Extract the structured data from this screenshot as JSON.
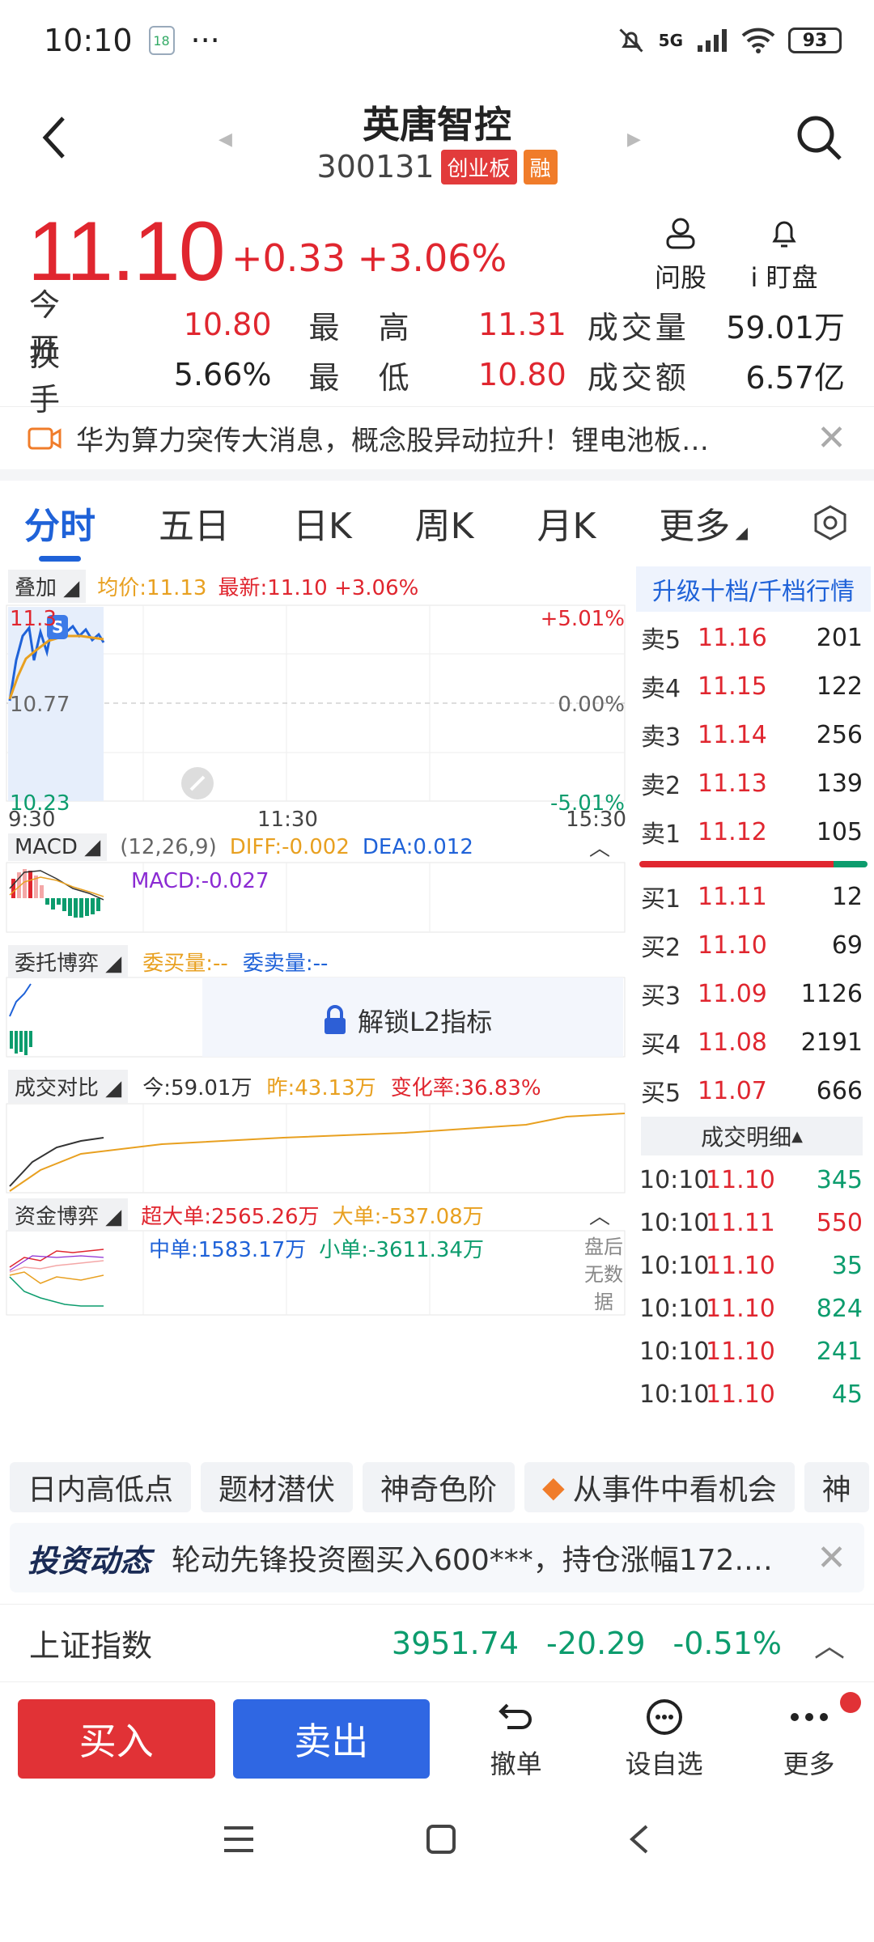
{
  "status": {
    "time": "10:10",
    "badge": "18",
    "dots": "···",
    "net": "5G",
    "battery": "93"
  },
  "header": {
    "title": "英唐智控",
    "code": "300131",
    "board_tag": "创业板",
    "margin_tag": "融"
  },
  "price": {
    "last": "11.10",
    "change": "+0.33",
    "pct": "+3.06%",
    "ask_label": "问股",
    "watch_label": "i 盯盘"
  },
  "quotes": {
    "rows": [
      {
        "l1": "今 开",
        "v1": "10.80",
        "c1": "red",
        "l2": "最 高",
        "v2": "11.31",
        "c2": "red",
        "l3": "成交量",
        "v3": "59.01万"
      },
      {
        "l1": "换 手",
        "v1": "5.66%",
        "c1": "dark",
        "l2": "最 低",
        "v2": "10.80",
        "c2": "red",
        "l3": "成交额",
        "v3": "6.57亿"
      }
    ]
  },
  "news": {
    "text": "华为算力突传大消息，概念股异动拉升！锂电池板…",
    "close": "✕"
  },
  "tabs": [
    "分时",
    "五日",
    "日K",
    "周K",
    "月K",
    "更多"
  ],
  "chart": {
    "overlay": "叠加",
    "avg": "均价:11.13",
    "latest": "最新:11.10 +3.06%",
    "high": "11.3",
    "mid": "10.77",
    "low": "10.23",
    "pos": "+5.01%",
    "zero": "0.00%",
    "neg": "-5.01%",
    "t1": "9:30",
    "t2": "11:30",
    "t3": "15:30"
  },
  "macd": {
    "label": "MACD",
    "params": "(12,26,9)",
    "diff": "DIFF:-0.002",
    "dea": "DEA:0.012",
    "macd": "MACD:-0.027"
  },
  "entrust": {
    "label": "委托博弈",
    "buy": "委买量:--",
    "sell": "委卖量:--",
    "unlock": "解锁L2指标"
  },
  "volume": {
    "label": "成交对比",
    "today": "今:59.01万",
    "yest": "昨:43.13万",
    "rate": "变化率:36.83%"
  },
  "fund": {
    "label": "资金博弈",
    "xl": "超大单:2565.26万",
    "l": "大单:-537.08万",
    "m": "中单:1583.17万",
    "s": "小单:-3611.34万",
    "after1": "盘后",
    "after2": "无数",
    "after3": "据"
  },
  "orderbook": {
    "upgrade": "升级十档/千档行情",
    "asks": [
      {
        "l": "卖5",
        "p": "11.16",
        "v": "201"
      },
      {
        "l": "卖4",
        "p": "11.15",
        "v": "122"
      },
      {
        "l": "卖3",
        "p": "11.14",
        "v": "256"
      },
      {
        "l": "卖2",
        "p": "11.13",
        "v": "139"
      },
      {
        "l": "卖1",
        "p": "11.12",
        "v": "105"
      }
    ],
    "bids": [
      {
        "l": "买1",
        "p": "11.11",
        "v": "12"
      },
      {
        "l": "买2",
        "p": "11.10",
        "v": "69"
      },
      {
        "l": "买3",
        "p": "11.09",
        "v": "1126"
      },
      {
        "l": "买4",
        "p": "11.08",
        "v": "2191"
      },
      {
        "l": "买5",
        "p": "11.07",
        "v": "666"
      }
    ],
    "detail_title": "成交明细",
    "detail": [
      {
        "t": "10:10",
        "p": "11.10",
        "v": "345",
        "c": "green"
      },
      {
        "t": "10:10",
        "p": "11.11",
        "v": "550",
        "c": "red"
      },
      {
        "t": "10:10",
        "p": "11.10",
        "v": "35",
        "c": "green"
      },
      {
        "t": "10:10",
        "p": "11.10",
        "v": "824",
        "c": "green"
      },
      {
        "t": "10:10",
        "p": "11.10",
        "v": "241",
        "c": "green"
      },
      {
        "t": "10:10",
        "p": "11.10",
        "v": "45",
        "c": "green"
      }
    ]
  },
  "chips": [
    "日内高低点",
    "题材潜伏",
    "神奇色阶",
    "从事件中看机会",
    "神"
  ],
  "banner": {
    "brand": "投资动态",
    "text": "轮动先锋投资圈买入600***，持仓涨幅172.…",
    "close": "✕"
  },
  "index": {
    "name": "上证指数",
    "value": "3951.74",
    "change": "-20.29",
    "pct": "-0.51%"
  },
  "bottom": {
    "buy": "买入",
    "sell": "卖出",
    "cancel": "撤单",
    "fav": "设自选",
    "more": "更多"
  },
  "colors": {
    "up": "#e0262f",
    "down": "#0c9c6d",
    "accent": "#1f62d8"
  }
}
